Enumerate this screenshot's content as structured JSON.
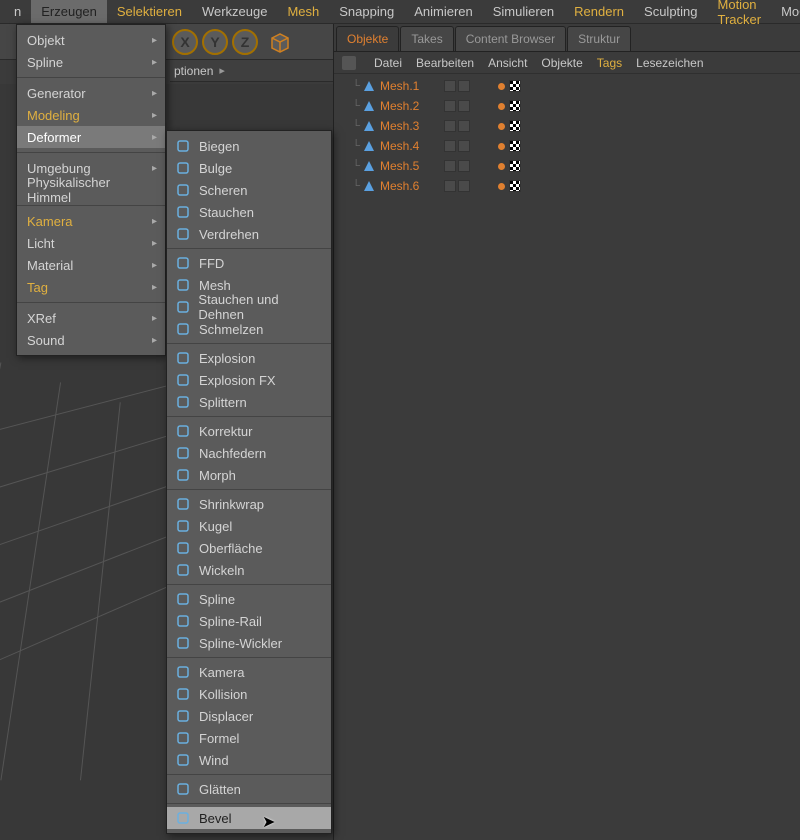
{
  "menubar": [
    {
      "label": "n",
      "sel": false
    },
    {
      "label": "Erzeugen",
      "sel": true,
      "yellow": false
    },
    {
      "label": "Selektieren",
      "sel": false,
      "yellow": true
    },
    {
      "label": "Werkzeuge",
      "sel": false
    },
    {
      "label": "Mesh",
      "sel": false,
      "yellow": true
    },
    {
      "label": "Snapping",
      "sel": false
    },
    {
      "label": "Animieren",
      "sel": false
    },
    {
      "label": "Simulieren",
      "sel": false
    },
    {
      "label": "Rendern",
      "sel": false,
      "yellow": true
    },
    {
      "label": "Sculpting",
      "sel": false
    },
    {
      "label": "Motion Tracker",
      "sel": false,
      "yellow": true
    },
    {
      "label": "MoGraph",
      "sel": false
    }
  ],
  "axis": [
    "X",
    "Y",
    "Z"
  ],
  "optbar": {
    "label": "ptionen"
  },
  "menu1": [
    {
      "t": "item",
      "label": "Objekt",
      "sub": true
    },
    {
      "t": "item",
      "label": "Spline",
      "sub": true
    },
    {
      "t": "sep"
    },
    {
      "t": "item",
      "label": "Generator",
      "sub": true
    },
    {
      "t": "item",
      "label": "Modeling",
      "sub": true,
      "yellow": true
    },
    {
      "t": "item",
      "label": "Deformer",
      "sub": true,
      "hl": true
    },
    {
      "t": "sep"
    },
    {
      "t": "item",
      "label": "Umgebung",
      "sub": true
    },
    {
      "t": "item",
      "label": "Physikalischer Himmel",
      "sub": false
    },
    {
      "t": "sep"
    },
    {
      "t": "item",
      "label": "Kamera",
      "sub": true,
      "yellow": true
    },
    {
      "t": "item",
      "label": "Licht",
      "sub": true
    },
    {
      "t": "item",
      "label": "Material",
      "sub": true
    },
    {
      "t": "item",
      "label": "Tag",
      "sub": true,
      "yellow": true
    },
    {
      "t": "sep"
    },
    {
      "t": "item",
      "label": "XRef",
      "sub": true
    },
    {
      "t": "item",
      "label": "Sound",
      "sub": true
    }
  ],
  "menu2": [
    {
      "t": "item",
      "label": "Biegen"
    },
    {
      "t": "item",
      "label": "Bulge"
    },
    {
      "t": "item",
      "label": "Scheren"
    },
    {
      "t": "item",
      "label": "Stauchen"
    },
    {
      "t": "item",
      "label": "Verdrehen"
    },
    {
      "t": "sep"
    },
    {
      "t": "item",
      "label": "FFD"
    },
    {
      "t": "item",
      "label": "Mesh"
    },
    {
      "t": "item",
      "label": "Stauchen und Dehnen"
    },
    {
      "t": "item",
      "label": "Schmelzen"
    },
    {
      "t": "sep"
    },
    {
      "t": "item",
      "label": "Explosion"
    },
    {
      "t": "item",
      "label": "Explosion FX"
    },
    {
      "t": "item",
      "label": "Splittern"
    },
    {
      "t": "sep"
    },
    {
      "t": "item",
      "label": "Korrektur"
    },
    {
      "t": "item",
      "label": "Nachfedern"
    },
    {
      "t": "item",
      "label": "Morph"
    },
    {
      "t": "sep"
    },
    {
      "t": "item",
      "label": "Shrinkwrap"
    },
    {
      "t": "item",
      "label": "Kugel"
    },
    {
      "t": "item",
      "label": "Oberfläche"
    },
    {
      "t": "item",
      "label": "Wickeln"
    },
    {
      "t": "sep"
    },
    {
      "t": "item",
      "label": "Spline"
    },
    {
      "t": "item",
      "label": "Spline-Rail"
    },
    {
      "t": "item",
      "label": "Spline-Wickler"
    },
    {
      "t": "sep"
    },
    {
      "t": "item",
      "label": "Kamera"
    },
    {
      "t": "item",
      "label": "Kollision"
    },
    {
      "t": "item",
      "label": "Displacer"
    },
    {
      "t": "item",
      "label": "Formel"
    },
    {
      "t": "item",
      "label": "Wind"
    },
    {
      "t": "sep"
    },
    {
      "t": "item",
      "label": "Glätten"
    },
    {
      "t": "sep"
    },
    {
      "t": "item",
      "label": "Bevel",
      "hl": true
    }
  ],
  "rtabs": [
    {
      "label": "Objekte",
      "active": true
    },
    {
      "label": "Takes"
    },
    {
      "label": "Content Browser"
    },
    {
      "label": "Struktur"
    }
  ],
  "rmenu": [
    {
      "label": "Datei"
    },
    {
      "label": "Bearbeiten"
    },
    {
      "label": "Ansicht"
    },
    {
      "label": "Objekte"
    },
    {
      "label": "Tags",
      "yellow": true
    },
    {
      "label": "Lesezeichen"
    }
  ],
  "objects": [
    {
      "name": "Mesh.1"
    },
    {
      "name": "Mesh.2"
    },
    {
      "name": "Mesh.3"
    },
    {
      "name": "Mesh.4"
    },
    {
      "name": "Mesh.5"
    },
    {
      "name": "Mesh.6"
    }
  ]
}
